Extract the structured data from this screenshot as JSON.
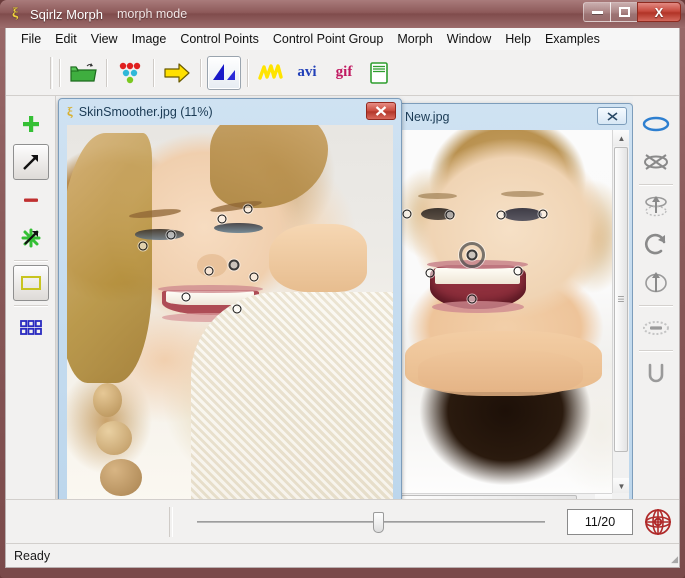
{
  "window": {
    "app_title": "Sqirlz Morph",
    "mode_label": "morph mode",
    "app_icon": "sqirlz-logo-icon",
    "buttons": {
      "minimize": "minimize-icon",
      "maximize": "maximize-icon",
      "close": "X"
    }
  },
  "menubar": {
    "items": [
      {
        "label": "File"
      },
      {
        "label": "Edit"
      },
      {
        "label": "View"
      },
      {
        "label": "Image"
      },
      {
        "label": "Control Points"
      },
      {
        "label": "Control Point Group"
      },
      {
        "label": "Morph"
      },
      {
        "label": "Window"
      },
      {
        "label": "Help"
      },
      {
        "label": "Examples"
      }
    ]
  },
  "toolbar": {
    "items": [
      {
        "name": "open-folder-icon",
        "label": "",
        "active": false
      },
      {
        "name": "control-points-icon",
        "label": "",
        "active": false
      },
      {
        "name": "yellow-arrow-icon",
        "label": "",
        "active": false
      },
      {
        "name": "morph-triangles-icon",
        "label": "",
        "active": true
      },
      {
        "name": "warp-squiggle-icon",
        "label": "",
        "active": false
      },
      {
        "name": "avi-export-icon",
        "label": "avi",
        "active": false
      },
      {
        "name": "gif-export-icon",
        "label": "gif",
        "active": false
      },
      {
        "name": "flash-export-icon",
        "label": "",
        "active": false
      }
    ]
  },
  "left_panel": {
    "items": [
      {
        "name": "add-point-tool",
        "glyph": "+",
        "active": false
      },
      {
        "name": "move-point-tool",
        "glyph": "↗",
        "active": true
      },
      {
        "name": "delete-point-tool",
        "glyph": "–",
        "active": false
      },
      {
        "name": "move-all-points-tool",
        "glyph": "↗",
        "active": false
      },
      {
        "name": "select-rectangle-tool",
        "glyph": "▭",
        "active": true
      },
      {
        "name": "grid-points-tool",
        "glyph": "▒",
        "active": false
      }
    ]
  },
  "right_panel": {
    "items": [
      {
        "name": "ellipse-shape-tool",
        "active": true
      },
      {
        "name": "no-cross-shape-tool",
        "active": false
      },
      {
        "name": "spin-up-tool",
        "active": false
      },
      {
        "name": "rotate-tool",
        "active": false
      },
      {
        "name": "flip-tool",
        "active": false
      },
      {
        "name": "blur-ellipse-tool",
        "active": false
      },
      {
        "name": "u-shape-tool",
        "active": false
      }
    ]
  },
  "windows": [
    {
      "id": "skinsmoother",
      "title": "SkinSmoother.jpg  (11%)",
      "icon": "sqirlz-logo-icon",
      "close_label": "✖",
      "close_style": "red",
      "active": true,
      "control_points": [
        {
          "x": 32.0,
          "y": 26.7,
          "type": "normal"
        },
        {
          "x": 24.6,
          "y": 29.6,
          "type": "normal"
        },
        {
          "x": 55.5,
          "y": 22.2,
          "type": "normal"
        },
        {
          "x": 47.6,
          "y": 24.9,
          "type": "normal"
        },
        {
          "x": 40.2,
          "y": 34.5,
          "type": "normal"
        },
        {
          "x": 51.1,
          "y": 33.1,
          "type": "selected"
        },
        {
          "x": 57.4,
          "y": 35.7,
          "type": "normal"
        },
        {
          "x": 36.6,
          "y": 41.0,
          "type": "normal"
        },
        {
          "x": 52.0,
          "y": 43.5,
          "type": "normal"
        }
      ]
    },
    {
      "id": "new",
      "title": "New.jpg",
      "close_label": "✖",
      "close_style": "plain",
      "active": false,
      "control_points": [
        {
          "x": 3.0,
          "y": 22.0,
          "type": "normal"
        },
        {
          "x": 22.0,
          "y": 22.3,
          "type": "normal"
        },
        {
          "x": 44.0,
          "y": 22.3,
          "type": "normal"
        },
        {
          "x": 62.5,
          "y": 22.2,
          "type": "normal"
        },
        {
          "x": 31.5,
          "y": 33.0,
          "type": "ring"
        },
        {
          "x": 13.0,
          "y": 37.5,
          "type": "normal"
        },
        {
          "x": 51.5,
          "y": 37.2,
          "type": "normal"
        },
        {
          "x": 31.5,
          "y": 44.5,
          "type": "normal"
        }
      ]
    }
  ],
  "player": {
    "frame_counter": "11/20",
    "slider_percent": 52,
    "target_button": "morph-target-icon"
  },
  "statusbar": {
    "text": "Ready"
  },
  "colors": {
    "titlebar_accent": "#8d5959",
    "close_red": "#c74a3e",
    "mdi_title_blue": "#bcd6ec",
    "panel_bg": "#f2f1f0",
    "toolbar_green": "#2f9e2f",
    "avi_blue": "#2240b8",
    "gif_pink": "#c01860",
    "grid_blue": "#2a2ac0"
  }
}
